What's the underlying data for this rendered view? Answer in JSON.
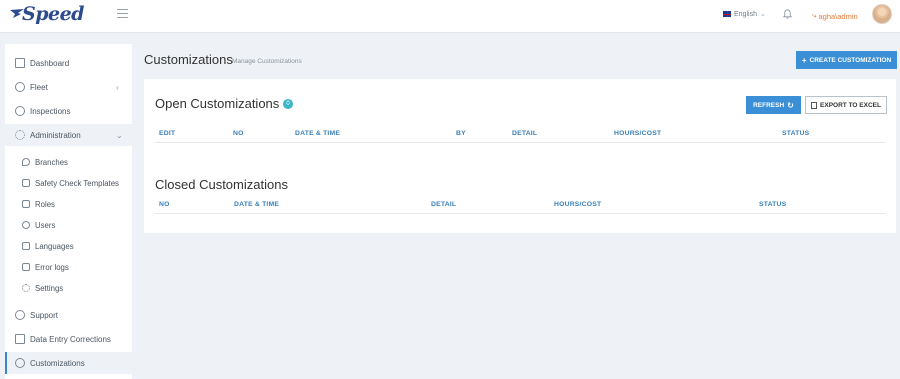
{
  "brand": {
    "name": "Speed"
  },
  "header": {
    "language": "English",
    "username": "agha\\admin"
  },
  "sidebar": {
    "items": [
      {
        "label": "Dashboard"
      },
      {
        "label": "Fleet"
      },
      {
        "label": "Inspections"
      },
      {
        "label": "Administration"
      }
    ],
    "admin_sub": [
      {
        "label": "Branches"
      },
      {
        "label": "Safety Check Templates"
      },
      {
        "label": "Roles"
      },
      {
        "label": "Users"
      },
      {
        "label": "Languages"
      },
      {
        "label": "Error logs"
      },
      {
        "label": "Settings"
      }
    ],
    "bottom": [
      {
        "label": "Support"
      },
      {
        "label": "Data Entry Corrections"
      },
      {
        "label": "Customizations"
      }
    ]
  },
  "page": {
    "title": "Customizations",
    "subtitle": "Manage Customizations",
    "create_label": "CREATE CUSTOMIZATION"
  },
  "open_section": {
    "title": "Open Customizations",
    "count": "0",
    "refresh_label": "REFRESH",
    "export_label": "EXPORT TO EXCEL",
    "columns": [
      "EDIT",
      "NO",
      "DATE & TIME",
      "BY",
      "DETAIL",
      "HOURS/COST",
      "STATUS"
    ]
  },
  "closed_section": {
    "title": "Closed Customizations",
    "columns": [
      "NO",
      "DATE & TIME",
      "DETAIL",
      "HOURS/COST",
      "STATUS"
    ]
  },
  "colors": {
    "accent": "#3a8fd6",
    "header_text": "#3a7fb8",
    "badge": "#3bb4c9"
  }
}
